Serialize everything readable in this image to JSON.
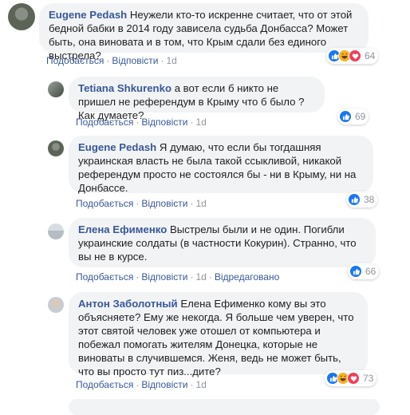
{
  "comments": [
    {
      "author": "Eugene Pedash",
      "text": "Неужели кто-то искренне считает, что от этой бедной бабки в 2014 году зависела судьба Донбасса? Может быть, она виновата и в том, что Крым сдали без единого выстрела?",
      "like": "Подобається",
      "reply": "Відповісти",
      "time": "1d",
      "reaction_count": "64"
    },
    {
      "author": "Tetiana Shkurenko",
      "text": "а вот если б никто не пришел не референдум в Крыму что б было ? Как думаете?",
      "like": "Подобається",
      "reply": "Відповісти",
      "time": "1d",
      "reaction_count": "69"
    },
    {
      "author": "Eugene Pedash",
      "text": "Я думаю, что если бы тогдашняя украинская власть не была такой ссыкливой, никакой референдум просто не состоялся бы - ни в Крыму, ни на Донбассе.",
      "like": "Подобається",
      "reply": "Відповісти",
      "time": "1d",
      "reaction_count": "38"
    },
    {
      "author": "Елена Ефименко",
      "text": "Выстрелы были и не один. Погибли украинские солдаты (в частности Кокурин). Странно, что вы не в курсе.",
      "like": "Подобається",
      "reply": "Відповісти",
      "time": "1d",
      "edited": "Відредаговано",
      "reaction_count": "66"
    },
    {
      "author": "Антон Заболотный",
      "text": "Елена Ефименко кому вы это объясняете? Ему же некогда. Я больше чем уверен, что этот святой человек уже отошел от компьютера и побежал помогать жителям Донецка, которые не виноваты в случившемся. Женя, ведь не может быть, что вы просто тут пиз...дите?",
      "like": "Подобається",
      "reply": "Відповісти",
      "time": "1d",
      "reaction_count": "73"
    }
  ],
  "colors": {
    "author": "#385898",
    "bubble": "#f2f3f5",
    "like": "#1877f2",
    "haha": "#f7b125",
    "love": "#f33e58"
  }
}
